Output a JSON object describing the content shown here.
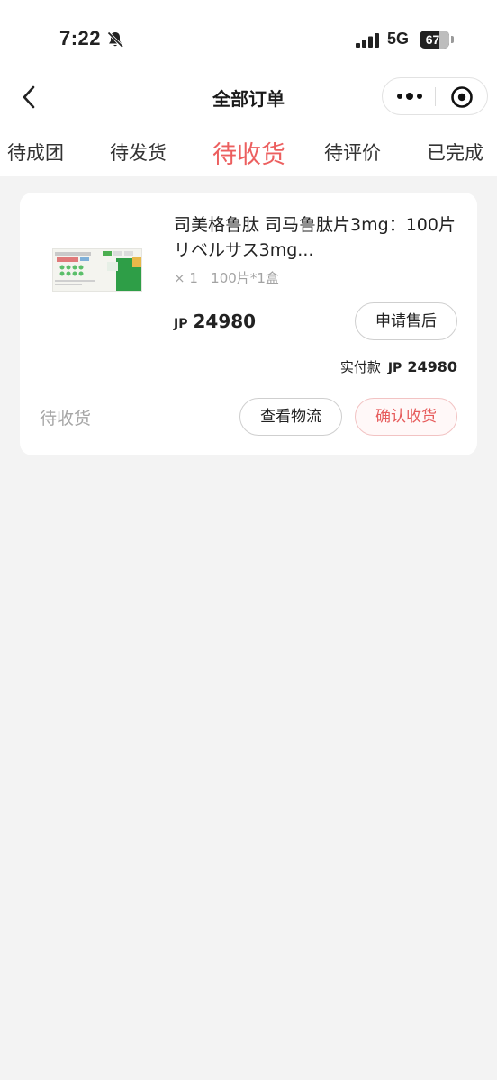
{
  "status_bar": {
    "time": "7:22",
    "network": "5G",
    "battery": "67"
  },
  "header": {
    "title": "全部订单"
  },
  "tabs": [
    {
      "label": "待成团"
    },
    {
      "label": "待发货"
    },
    {
      "label": "待收货",
      "active": true
    },
    {
      "label": "待评价"
    },
    {
      "label": "已完成"
    }
  ],
  "order": {
    "product_title": "司美格鲁肽 司马鲁肽片3mg：100片　リベルサス3mg...",
    "spec": "× 1   100片*1盒",
    "currency": "JP",
    "price": "24980",
    "after_sales_label": "申请售后",
    "paid_label": "实付款",
    "paid_currency": "JP",
    "paid_amount": "24980",
    "status": "待收货",
    "logistics_label": "查看物流",
    "confirm_label": "确认收货"
  },
  "colors": {
    "accent": "#ec5f5f",
    "background": "#f3f3f3",
    "card": "#ffffff",
    "muted_text": "#a6a6a6"
  },
  "icons": {
    "back": "chevron-left-icon",
    "more": "more-dots-icon",
    "close": "close-circle-icon",
    "bell": "bell-slash-icon",
    "signal": "signal-icon",
    "battery": "battery-icon"
  }
}
